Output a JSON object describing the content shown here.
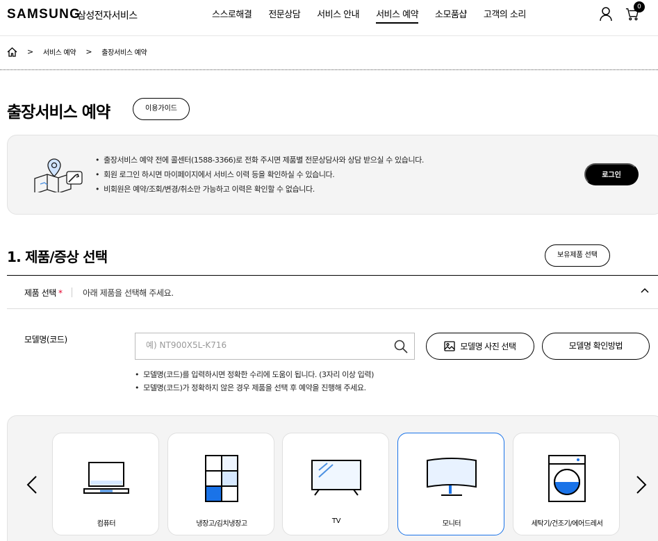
{
  "header": {
    "logo": "SAMSUNG",
    "logo_sub": "삼성전자서비스",
    "nav": [
      "스스로해결",
      "전문상담",
      "서비스 안내",
      "서비스 예약",
      "소모품샵",
      "고객의 소리"
    ],
    "cart_count": "0"
  },
  "breadcrumb": [
    "서비스 예약",
    "출장서비스 예약"
  ],
  "page": {
    "title": "출장서비스 예약",
    "guide_button": "이용가이드"
  },
  "notice": {
    "items": [
      "출장서비스 예약 전에 콜센터(1588-3366)로 전화 주시면 제품별 전문상담사와 상담 받으실 수 있습니다.",
      "회원 로그인 하시면 마이페이지에서 서비스 이력 등을 확인하실 수 있습니다.",
      "비회원은 예약/조회/변경/취소만 가능하고 이력은 확인할 수 없습니다."
    ],
    "login_button": "로그인"
  },
  "section1": {
    "title": "1. 제품/증상 선택",
    "owned_button": "보유제품 선택",
    "product_label": "제품 선택",
    "required_mark": "*",
    "product_hint": "아래 제품을 선택해 주세요."
  },
  "model": {
    "label": "모델명(코드)",
    "placeholder": "예) NT900X5L-K716",
    "value": "",
    "photo_button": "모델명 사진 선택",
    "how_button": "모델명 확인방법",
    "notes": [
      "모델명(코드)를 입력하시면 정확한 수리에 도움이 됩니다. (3자리 이상 입력)",
      "모델명(코드)가 정확하지 않은 경우 제품을 선택 후 예약을 진행해 주세요."
    ]
  },
  "categories": [
    {
      "label": "컴퓨터",
      "icon": "laptop-icon",
      "selected": false
    },
    {
      "label": "냉장고/김치냉장고",
      "icon": "refrigerator-icon",
      "selected": false
    },
    {
      "label": "TV",
      "icon": "tv-icon",
      "selected": false
    },
    {
      "label": "모니터",
      "icon": "monitor-icon",
      "selected": true
    },
    {
      "label": "세탁기/건조기/에어드레서",
      "icon": "washer-icon",
      "selected": false
    }
  ],
  "colors": {
    "accent_blue": "#1a73e8",
    "required_red": "#e4002b",
    "panel_gray": "#f4f4f4"
  }
}
